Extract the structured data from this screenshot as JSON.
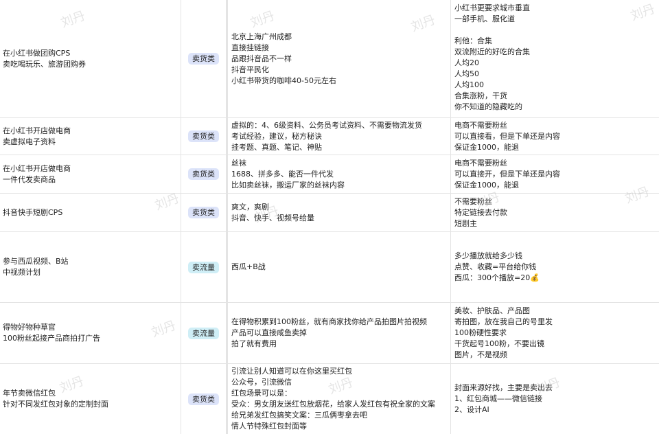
{
  "watermark": "刘丹",
  "colors": {
    "tag_sell_bg": "#dce3f9",
    "tag_flow_bg": "#cfeef6",
    "border": "#e4e4e4"
  },
  "rows": [
    {
      "project": [
        "在小红书做团购CPS",
        "卖吃喝玩乐、旅游团购券"
      ],
      "tag": "卖货类",
      "notes": [
        "北京上海广州成都",
        "直接挂链接",
        "品跟抖音品不一样",
        "抖音平民化",
        "小红书带货的咖啡40-50元左右"
      ],
      "extra": [
        "小红书更要求城市垂直",
        "一部手机、服化道",
        "",
        "利他：合集",
        "双流附近的好吃的合集",
        "人均20",
        "人均50",
        "人均100",
        "合集涨粉，干货",
        "你不知道的隐藏吃的"
      ]
    },
    {
      "project": [
        "在小红书开店做电商",
        "卖虚拟电子资料"
      ],
      "tag": "卖货类",
      "notes": [
        "虚拟的：4、6级资料、公务员考试资料、不需要物流发货",
        "考试经验，建议，秘方秘诀",
        "挂考题、真题、笔记、神贴"
      ],
      "extra": [
        "电商不需要粉丝",
        "可以直接看，但是下单还是内容",
        "保证金1000，能退"
      ]
    },
    {
      "project": [
        "在小红书开店做电商",
        "一件代发卖商品"
      ],
      "tag": "卖货类",
      "notes": [
        "丝袜",
        "1688、拼多多、能否一件代发",
        "比如卖丝袜，搬运厂家的丝袜内容"
      ],
      "extra": [
        "电商不需要粉丝",
        "可以直接开，但是下单还是内容",
        "保证金1000，能退"
      ]
    },
    {
      "project": [
        "抖音快手短剧CPS"
      ],
      "tag": "卖货类",
      "notes": [
        "爽文，爽剧",
        "抖音、快手、视频号给量"
      ],
      "extra": [
        "不需要粉丝",
        "特定链接去付款",
        "短剧主"
      ]
    },
    {
      "project": [
        "参与西瓜视频、B站",
        "中视频计划"
      ],
      "tag": "卖流量",
      "notes": [
        "西瓜+B战"
      ],
      "extra": [
        "多少播放就给多少钱",
        "点赞、收藏=平台给你钱",
        "西瓜：300个播放=20💰"
      ]
    },
    {
      "project": [
        "得物好物种草官",
        "100粉丝起接产品商拍打广告"
      ],
      "tag": "卖流量",
      "notes": [
        "在得物积累到100粉丝，就有商家找你给产品拍图片拍视频",
        "产品可以直接咸鱼卖掉",
        "拍了就有费用"
      ],
      "extra": [
        "美妆、护肤品、产品图",
        "寄拍图，放在我自己的号里发",
        "100粉硬性要求",
        "干货起号100粉，不要出镜",
        "图片，不是视频"
      ]
    },
    {
      "project": [
        "年节卖微信红包",
        "针对不同发红包对象的定制封面"
      ],
      "tag": "卖货类",
      "notes": [
        "引流让别人知道可以在你这里买红包",
        "公众号，引流微信",
        "红包场景可以是：",
        "受众：男女朋友送红包放烟花，给家人发红包有祝全家的文案",
        "给兄弟发红包搞笑文案：三瓜俩枣拿去吧",
        "情人节特殊红包封面等"
      ],
      "extra": [
        "封面来源好找，主要是卖出去",
        "1、红包商城——微信链接",
        "2、设计AI"
      ]
    }
  ]
}
